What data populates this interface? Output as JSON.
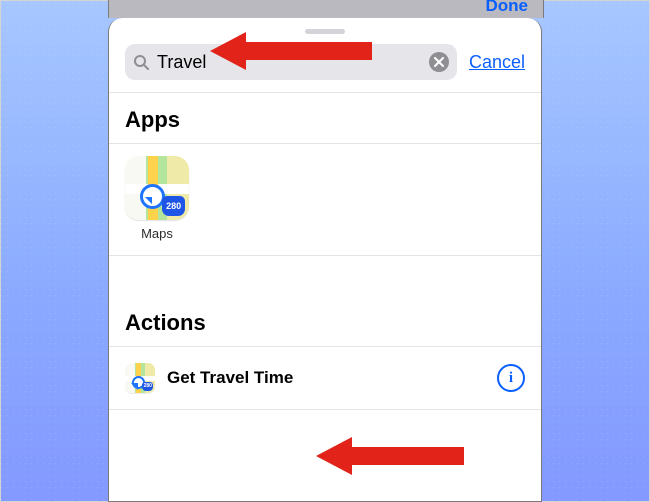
{
  "behind": {
    "done_label": "Done"
  },
  "search": {
    "value": "Travel",
    "cancel_label": "Cancel"
  },
  "sections": {
    "apps_title": "Apps",
    "actions_title": "Actions"
  },
  "apps": {
    "maps": {
      "label": "Maps"
    }
  },
  "actions": {
    "get_travel_time": {
      "label": "Get Travel Time",
      "shield": "280"
    }
  },
  "icons": {
    "maps_shield": "280"
  },
  "info_glyph": "i"
}
